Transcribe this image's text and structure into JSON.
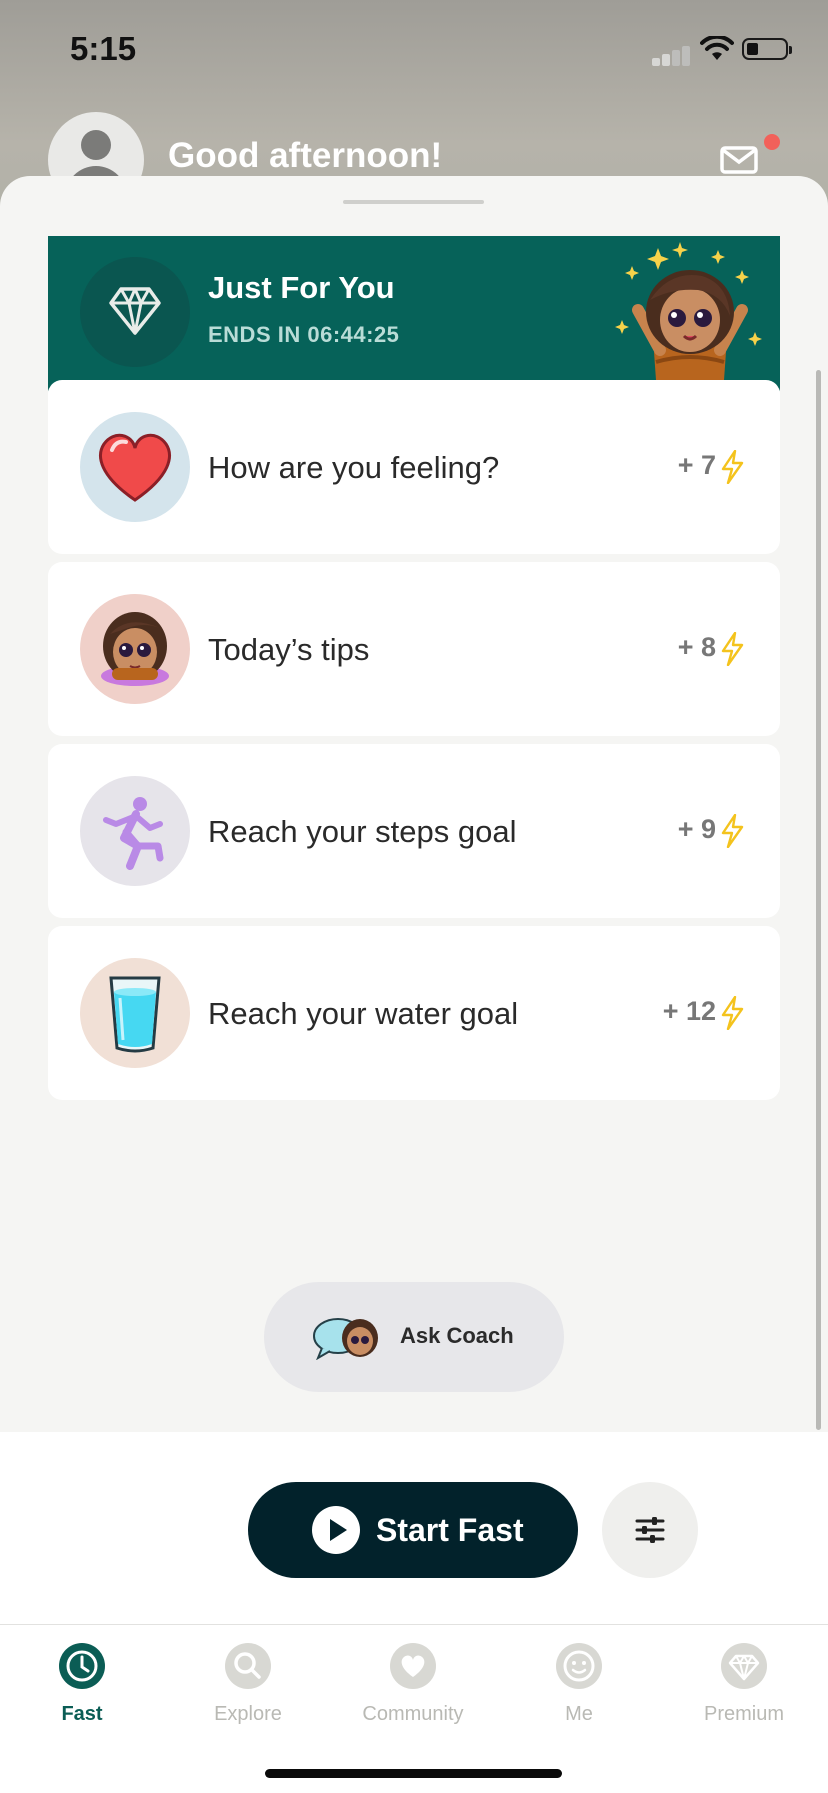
{
  "status_bar": {
    "time": "5:15"
  },
  "header": {
    "greeting": "Good afternoon!"
  },
  "promo": {
    "title": "Just For You",
    "timer": "ENDS IN 06:44:25"
  },
  "tasks": [
    {
      "label": "How are you feeling?",
      "points": "+ 7",
      "icon": "heart-icon"
    },
    {
      "label": "Today’s tips",
      "points": "+ 8",
      "icon": "coach-avatar-icon"
    },
    {
      "label": "Reach your steps goal",
      "points": "+ 9",
      "icon": "running-person-icon"
    },
    {
      "label": "Reach your water goal",
      "points": "+ 12",
      "icon": "water-glass-icon"
    }
  ],
  "ask_coach": {
    "label": "Ask Coach"
  },
  "actions": {
    "start_fast_label": "Start Fast"
  },
  "tabs": [
    {
      "label": "Fast",
      "icon": "clock-icon",
      "active": true
    },
    {
      "label": "Explore",
      "icon": "search-icon",
      "active": false
    },
    {
      "label": "Community",
      "icon": "heart-icon",
      "active": false
    },
    {
      "label": "Me",
      "icon": "smiley-icon",
      "active": false
    },
    {
      "label": "Premium",
      "icon": "diamond-icon",
      "active": false
    }
  ],
  "colors": {
    "brand_teal": "#066259",
    "dark_button": "#02222b",
    "active_tab": "#0b5d55",
    "inactive_tab": "#c2c2bd",
    "bolt": "#f4c31d",
    "notification_dot": "#f2615a"
  }
}
